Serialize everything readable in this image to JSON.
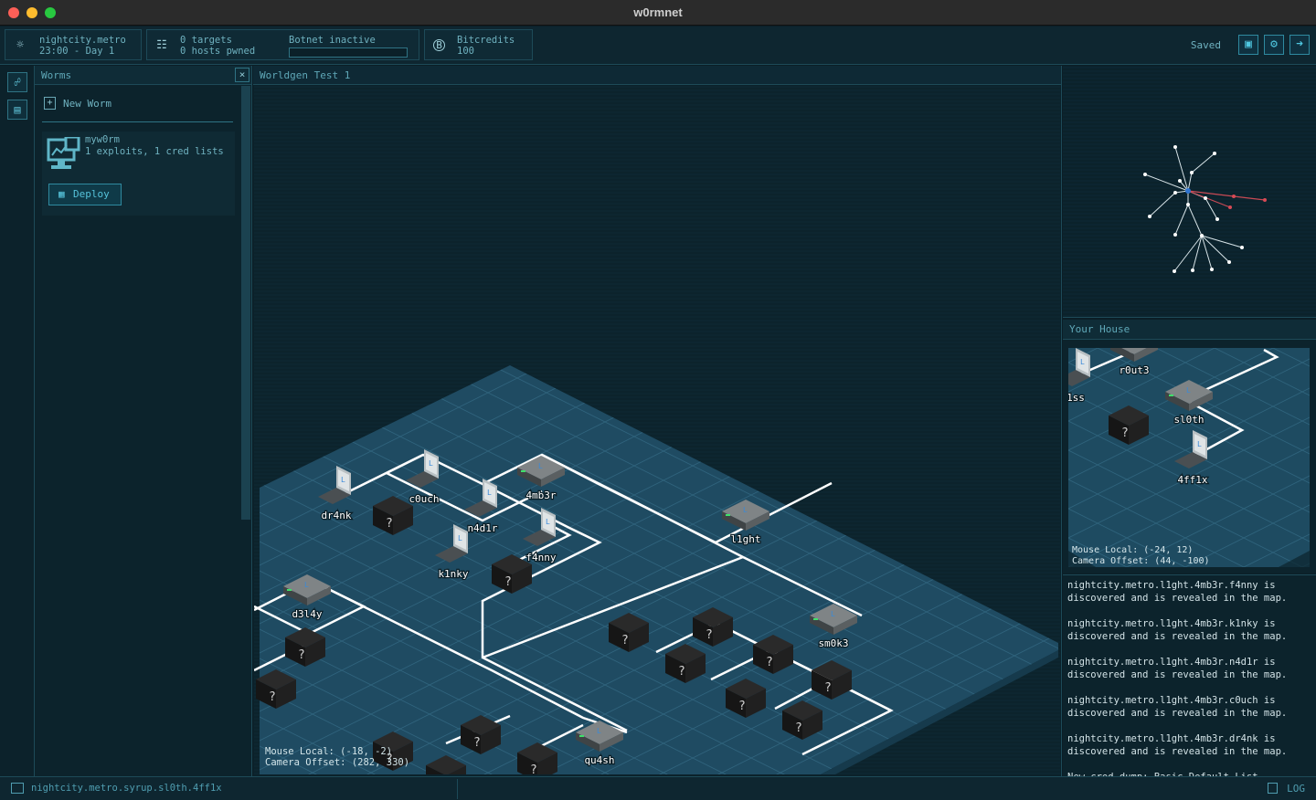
{
  "window": {
    "title": "w0rmnet"
  },
  "topbar": {
    "location": "nightcity.metro",
    "time": "23:00 - Day 1",
    "targets": "0 targets",
    "hosts": "0 hosts pwned",
    "botnet": "Botnet inactive",
    "currency_label": "Bitcredits",
    "currency_value": "100",
    "saved": "Saved"
  },
  "worms_panel": {
    "title": "Worms",
    "new_worm": "New Worm",
    "worm": {
      "name": "myw0rm",
      "desc": "1 exploits, 1 cred lists",
      "deploy": "Deploy"
    }
  },
  "map": {
    "title": "Worldgen Test 1",
    "mouse_local": "Mouse Local: (-18, -2)",
    "camera_offset": "Camera Offset: (282, 330)",
    "nodes": [
      {
        "label": "dr4nk",
        "kind": "laptop"
      },
      {
        "label": "c0uch",
        "kind": "laptop"
      },
      {
        "label": "4mb3r",
        "kind": "router"
      },
      {
        "label": "n4d1r",
        "kind": "laptop"
      },
      {
        "label": "f4nny",
        "kind": "laptop"
      },
      {
        "label": "k1nky",
        "kind": "laptop"
      },
      {
        "label": "l1ght",
        "kind": "router"
      },
      {
        "label": "d3l4y",
        "kind": "router"
      },
      {
        "label": "sm0k3",
        "kind": "router"
      },
      {
        "label": "qu4sh",
        "kind": "router"
      }
    ],
    "unknown_label": "?"
  },
  "house_panel": {
    "title": "Your House",
    "nodes": [
      {
        "label": "r0ut3"
      },
      {
        "label": "1ss"
      },
      {
        "label": "sl0th"
      },
      {
        "label": "4ff1x"
      }
    ],
    "unknown_label": "?",
    "mouse_local": "Mouse Local: (-24, 12)",
    "camera_offset": "Camera Offset: (44, -100)"
  },
  "log": {
    "entries": [
      "nightcity.metro.l1ght.4mb3r.f4nny is discovered and is revealed in the map.",
      "nightcity.metro.l1ght.4mb3r.k1nky is discovered and is revealed in the map.",
      "nightcity.metro.l1ght.4mb3r.n4d1r is discovered and is revealed in the map.",
      "nightcity.metro.l1ght.4mb3r.c0uch is discovered and is revealed in the map.",
      "nightcity.metro.l1ght.4mb3r.dr4nk is discovered and is revealed in the map.",
      "New cred dump: Basic Default List"
    ]
  },
  "bottombar": {
    "path": "nightcity.metro.syrup.sl0th.4ff1x",
    "log": "LOG"
  },
  "colors": {
    "accent": "#56c2da",
    "wire": "#ffffff",
    "grid": "#2b5c72"
  },
  "icons": [
    "globe-icon",
    "targets-icon",
    "bitcoin-icon",
    "save-icon",
    "gear-icon",
    "exit-icon",
    "network-icon",
    "worm-icon",
    "close-icon",
    "new-file-icon",
    "deploy-icon",
    "log-icon"
  ]
}
